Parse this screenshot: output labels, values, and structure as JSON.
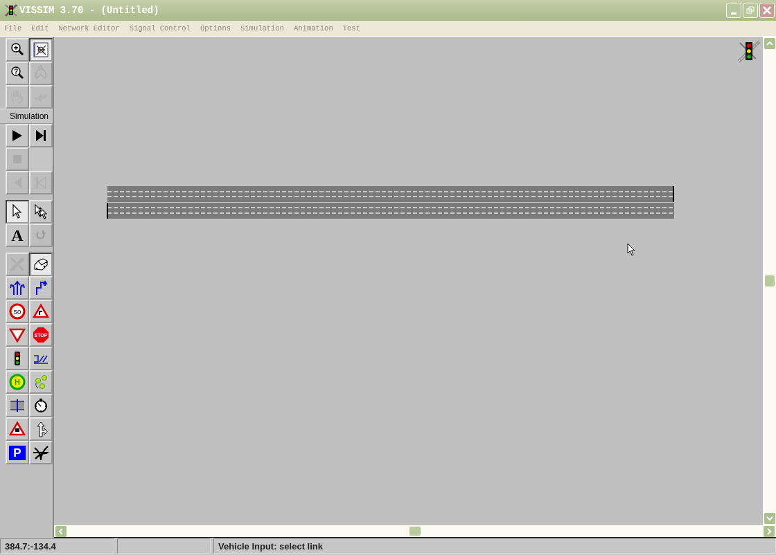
{
  "window": {
    "title": "VISSIM 3.70 - (Untitled)"
  },
  "menu": [
    {
      "label": "File"
    },
    {
      "label": "Edit"
    },
    {
      "label": "Network Editor"
    },
    {
      "label": "Signal Control"
    },
    {
      "label": "Options"
    },
    {
      "label": "Simulation"
    },
    {
      "label": "Animation"
    },
    {
      "label": "Test"
    }
  ],
  "toolbar": {
    "sections": [
      {
        "buttons": [
          {
            "kind": "button",
            "selected": false,
            "disabled": false
          },
          {
            "kind": "button",
            "selected": true,
            "disabled": false
          },
          {
            "kind": "button",
            "selected": false,
            "disabled": false
          },
          {
            "kind": "button",
            "selected": false,
            "disabled": true
          },
          {
            "kind": "button",
            "selected": false,
            "disabled": true
          },
          {
            "kind": "button",
            "selected": false,
            "disabled": true
          }
        ]
      },
      {
        "label": "Simulation",
        "buttons": [
          {
            "kind": "button",
            "selected": false,
            "disabled": false
          },
          {
            "kind": "button",
            "selected": false,
            "disabled": false
          },
          {
            "kind": "button",
            "selected": false,
            "disabled": true
          },
          {
            "kind": "spacer"
          },
          {
            "kind": "button",
            "selected": false,
            "disabled": true
          },
          {
            "kind": "button",
            "selected": false,
            "disabled": true
          }
        ]
      },
      {
        "buttons": [
          {
            "kind": "button",
            "selected": true,
            "disabled": false
          },
          {
            "kind": "button",
            "selected": false,
            "disabled": false
          },
          {
            "kind": "button",
            "selected": false,
            "disabled": false,
            "text": "A"
          },
          {
            "kind": "button",
            "selected": false,
            "disabled": true
          }
        ]
      },
      {
        "buttons": [
          {
            "kind": "button",
            "selected": false,
            "disabled": true
          },
          {
            "kind": "button",
            "selected": true,
            "disabled": false
          },
          {
            "kind": "button",
            "selected": false,
            "disabled": false
          },
          {
            "kind": "button",
            "selected": false,
            "disabled": false
          },
          {
            "kind": "button",
            "selected": false,
            "disabled": false,
            "text": "50"
          },
          {
            "kind": "button",
            "selected": false,
            "disabled": false
          },
          {
            "kind": "button",
            "selected": false,
            "disabled": false
          },
          {
            "kind": "button",
            "selected": false,
            "disabled": false,
            "text": "STOP"
          },
          {
            "kind": "button",
            "selected": false,
            "disabled": false
          },
          {
            "kind": "button",
            "selected": false,
            "disabled": false
          },
          {
            "kind": "button",
            "selected": false,
            "disabled": false,
            "text": "H"
          },
          {
            "kind": "button",
            "selected": false,
            "disabled": false
          },
          {
            "kind": "button",
            "selected": false,
            "disabled": false
          },
          {
            "kind": "button",
            "selected": false,
            "disabled": false
          },
          {
            "kind": "button",
            "selected": false,
            "disabled": false
          },
          {
            "kind": "button",
            "selected": false,
            "disabled": false
          },
          {
            "kind": "button",
            "selected": false,
            "disabled": false,
            "text": "P"
          },
          {
            "kind": "button",
            "selected": false,
            "disabled": false
          }
        ]
      }
    ]
  },
  "status_bar": {
    "position": "384.7:-134.4",
    "message": "Vehicle Input: select link"
  }
}
